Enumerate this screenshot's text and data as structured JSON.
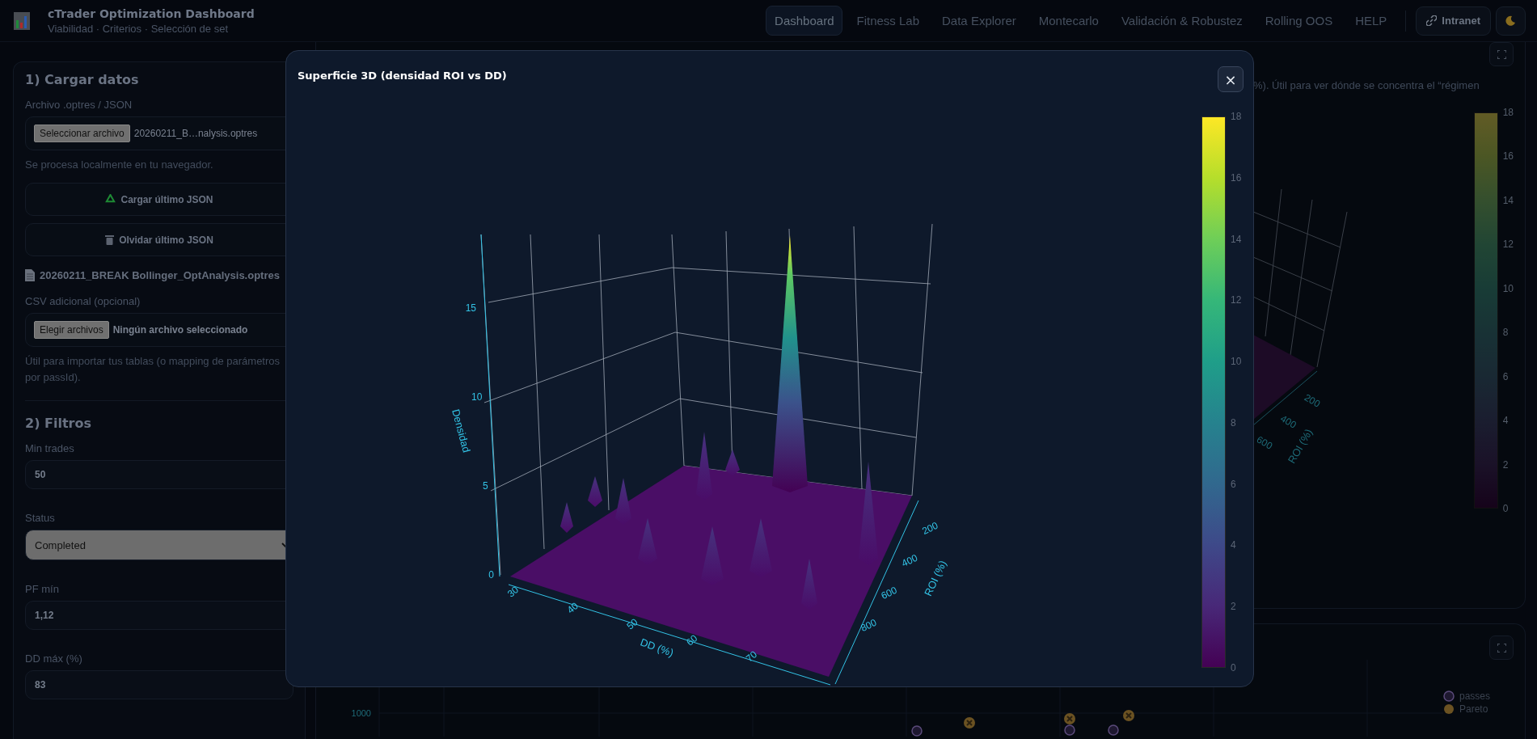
{
  "header": {
    "title": "cTrader Optimization Dashboard",
    "subtitle": "Viabilidad · Criterios · Selección de set"
  },
  "nav": [
    {
      "label": "Dashboard",
      "selected": true
    },
    {
      "label": "Fitness Lab",
      "selected": false
    },
    {
      "label": "Data Explorer",
      "selected": false
    },
    {
      "label": "Montecarlo",
      "selected": false
    },
    {
      "label": "Validación & Robustez",
      "selected": false
    },
    {
      "label": "Rolling OOS",
      "selected": false
    },
    {
      "label": "HELP",
      "selected": false
    }
  ],
  "intranet_button": "Intranet",
  "sidebar": {
    "load": {
      "title": "1) Cargar datos",
      "file_label": "Archivo .optres / JSON",
      "file_button": "Seleccionar archivo",
      "file_value": "20260211_B…nalysis.optres",
      "file_hint": "Se procesa localmente en tu navegador.",
      "actions": [
        {
          "kind": "reload",
          "label": "Cargar último JSON"
        },
        {
          "kind": "forget",
          "label": "Olvidar último JSON"
        }
      ],
      "loaded_file": "20260211_BREAK Bollinger_OptAnalysis.optres",
      "csv_label": "CSV adicional (opcional)",
      "csv_button": "Elegir archivos",
      "csv_value": "Ningún archivo seleccionado",
      "csv_hint": "Útil para importar tus tablas (o mapping de parámetros por passId)."
    },
    "filters": {
      "title": "2) Filtros",
      "fields": [
        {
          "kind": "input",
          "label": "Min trades",
          "value": "50"
        },
        {
          "kind": "select",
          "label": "Status",
          "value": "Completed"
        },
        {
          "kind": "input",
          "label": "PF mín",
          "value": "1,12"
        },
        {
          "kind": "input",
          "label": "DD máx (%)",
          "value": "83"
        }
      ]
    }
  },
  "surface_card": {
    "description": "%). Útil para ver dónde se concentra el “régimen",
    "roi_title": "ROI (%)",
    "roi_ticks": [
      "200",
      "400",
      "600"
    ],
    "colorbar_ticks": [
      "18",
      "16",
      "14",
      "12",
      "10",
      "8",
      "6",
      "4",
      "2",
      "0"
    ]
  },
  "scatter_card": {
    "y_tick": "1000",
    "legend": [
      "passes",
      "Pareto"
    ]
  },
  "modal": {
    "title": "Superficie 3D (densidad ROI vs DD)",
    "close": "×",
    "z_axis": {
      "title": "Densidad",
      "ticks": [
        "0",
        "5",
        "10",
        "15"
      ]
    },
    "x_axis": {
      "title": "DD (%)",
      "ticks": [
        "30",
        "40",
        "50",
        "60",
        "70"
      ]
    },
    "y_axis": {
      "title": "ROI (%)",
      "ticks": [
        "200",
        "400",
        "600",
        "800"
      ]
    },
    "colorbar_ticks": [
      "18",
      "16",
      "14",
      "12",
      "10",
      "8",
      "6",
      "4",
      "2",
      "0"
    ]
  }
}
